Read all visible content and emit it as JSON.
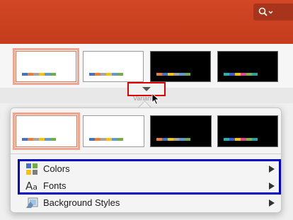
{
  "ribbon": {
    "search_icon": "search-icon",
    "accent": "#d24726"
  },
  "variants_label": "Variants",
  "swatch_colors": {
    "light": [
      "#4472c4",
      "#ed7d31",
      "#a5a5a5",
      "#ffc000",
      "#5b9bd5",
      "#70ad47"
    ],
    "dark": [
      "#ed7d31",
      "#4472c4",
      "#f2c500",
      "#a5a5a5",
      "#5b9bd5",
      "#70ad47"
    ],
    "dark2": [
      "#1fb5ad",
      "#3b5bdb",
      "#f2c500",
      "#e84393",
      "#7cb342",
      "#26a69a"
    ]
  },
  "menu": {
    "items": [
      {
        "label": "Colors",
        "icon": "colors-icon"
      },
      {
        "label": "Fonts",
        "icon": "fonts-icon"
      },
      {
        "label": "Background Styles",
        "icon": "background-styles-icon"
      }
    ]
  }
}
